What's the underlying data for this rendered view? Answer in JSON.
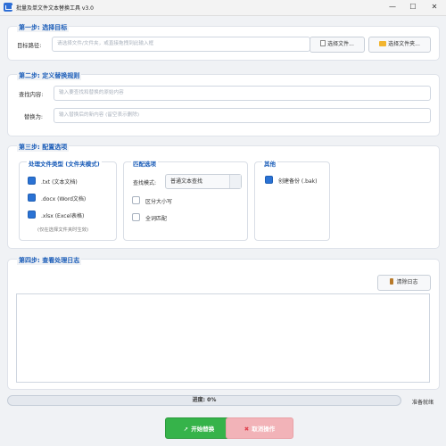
{
  "window": {
    "title": "批量及单文件文本替换工具 v3.0",
    "minimize": "—",
    "maximize": "☐",
    "close": "✕"
  },
  "step1": {
    "title": "第一步: 选择目标",
    "path_label": "目标路径:",
    "path_placeholder": "请选择文件/文件夹，或直接拖拽到此输入框",
    "select_file_label": "选择文件...",
    "select_folder_label": "选择文件夹..."
  },
  "step2": {
    "title": "第二步: 定义替换规则",
    "find_label": "查找内容:",
    "find_placeholder": "输入要查找和替换的原始内容",
    "replace_label": "替换为:",
    "replace_placeholder": "输入替换后的新内容 (留空表示删除)"
  },
  "step3": {
    "title": "第三步: 配置选项",
    "file_types": {
      "title": "处理文件类型 (文件夹模式)",
      "items": [
        {
          "label": ".txt (文本文档)",
          "checked": true
        },
        {
          "label": ".docx (Word文档)",
          "checked": true
        },
        {
          "label": ".xlsx (Excel表格)",
          "checked": true
        }
      ],
      "note": "(仅在选择文件夹时生效)"
    },
    "match": {
      "title": "匹配选项",
      "mode_label": "查找模式:",
      "mode_value": "普通文本查找",
      "options": [
        {
          "label": "区分大小写",
          "checked": false
        },
        {
          "label": "全词匹配",
          "checked": false
        }
      ]
    },
    "other": {
      "title": "其他",
      "options": [
        {
          "label": "创建备份 (.bak)",
          "checked": true
        }
      ]
    }
  },
  "step4": {
    "title": "第四步: 查看处理日志",
    "clear_label": "清除日志"
  },
  "footer": {
    "progress_text": "进度: 0%",
    "progress_value": 0,
    "status": "准备就绪",
    "start_label": "开始替换",
    "cancel_label": "取消操作"
  },
  "colors": {
    "accent": "#2a72d4",
    "start": "#36b34a",
    "cancel": "#f2b3b8",
    "heading": "#1a5cb8"
  }
}
